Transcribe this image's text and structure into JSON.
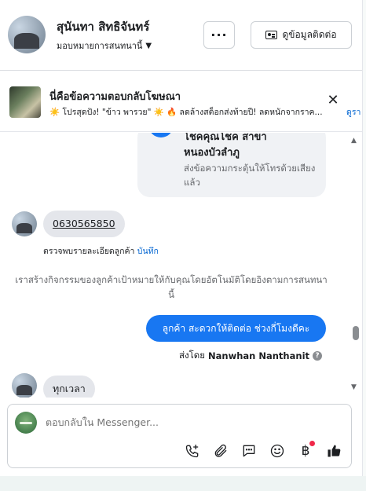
{
  "header": {
    "contact_name": "สุนันทา สิทธิจันทร์",
    "assignment": "มอบหมายการสนทนานี้",
    "more_label": "···",
    "contact_info_label": "ดูข้อมูลติดต่อ"
  },
  "ad_reply": {
    "title": "นี่คือข้อความตอบกลับโฆษณา",
    "text": "☀️ โปรสุดปัง! \"ข้าว พารวย\" ☀️ 🔥 ลดล้างสต็อกส่งท้ายปี! ลดหนักจากราค...",
    "link": "ดูรา",
    "close_label": "✕"
  },
  "conversation": {
    "bot_card_title": "โชคคุณโชค สาขาหนองบัวลำภู",
    "bot_card_subtitle": "ส่งข้อความกระตุ้นให้โทรด้วยเสียงแล้ว",
    "phone_message": "0630565850",
    "detail_text": "ตรวจพบรายละเอียดลูกค้า",
    "detail_link": "บันทึก",
    "system_message": "เราสร้างกิจกรรมของลูกค้าเป้าหมายให้กับคุณโดยอัตโนมัติโดยอิงตามการสนทนานี้",
    "outgoing_message": "ลูกค้า สะดวกให้ติดต่อ ช่วงกี่โมงดีคะ",
    "sent_by_prefix": "ส่งโดย",
    "sent_by_name": "Nanwhan Nanthanit",
    "help_label": "?",
    "last_message": "ทุกเวลา"
  },
  "composer": {
    "placeholder": "ตอบกลับใน Messenger...",
    "currency_symbol": "฿"
  },
  "icons": [
    "call-add-icon",
    "attachment-icon",
    "saved-replies-icon",
    "emoji-icon",
    "payment-icon",
    "like-icon",
    "close-icon",
    "chevron-down-icon",
    "help-icon"
  ],
  "colors": {
    "accent": "#1877f2",
    "link": "#0064d1",
    "bubble_in": "#e4e6eb",
    "notification_dot": "#f02849"
  }
}
